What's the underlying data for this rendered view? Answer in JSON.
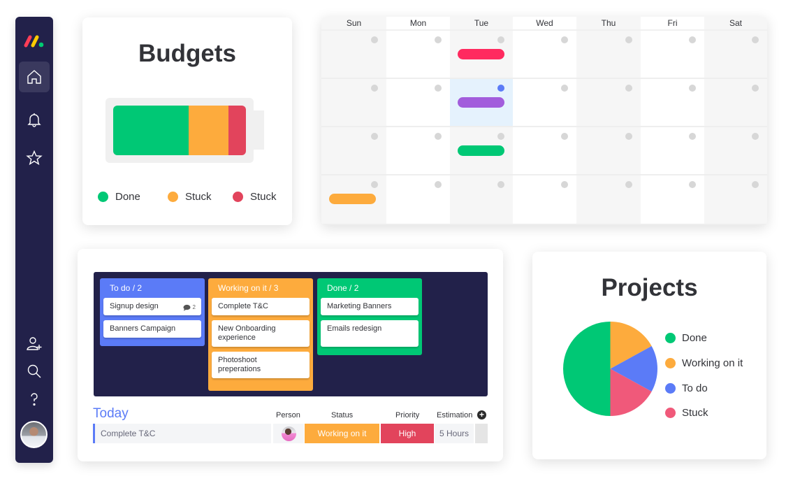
{
  "colors": {
    "navy": "#22214a",
    "green": "#00c875",
    "orange": "#fdab3d",
    "red": "#e2445c",
    "pink_red": "#ff2a5f",
    "purple": "#a25ddc",
    "blue": "#5b7bf7",
    "stuck_pink": "#f0597a"
  },
  "sidebar": {
    "items": [
      {
        "name": "home",
        "label": "Home",
        "active": true
      },
      {
        "name": "notifications",
        "label": "Notifications"
      },
      {
        "name": "favorites",
        "label": "Favorites"
      },
      {
        "name": "invite",
        "label": "Invite members"
      },
      {
        "name": "search",
        "label": "Search"
      },
      {
        "name": "help",
        "label": "Help"
      }
    ]
  },
  "budgets": {
    "title": "Budgets",
    "segments": [
      {
        "label": "Done",
        "fraction": 0.57,
        "color": "#00c875"
      },
      {
        "label": "Stuck",
        "fraction": 0.3,
        "color": "#fdab3d"
      },
      {
        "label": "Stuck",
        "fraction": 0.13,
        "color": "#e2445c"
      }
    ],
    "legend": [
      "Done",
      "Stuck",
      "Stuck"
    ]
  },
  "calendar": {
    "days": [
      "Sun",
      "Mon",
      "Tue",
      "Wed",
      "Thu",
      "Fri",
      "Sat"
    ],
    "weeks": 4,
    "events": [
      {
        "week": 0,
        "day": 2,
        "color": "#ff2a5f"
      },
      {
        "week": 1,
        "day": 2,
        "color": "#a25ddc"
      },
      {
        "week": 2,
        "day": 2,
        "color": "#00c875"
      },
      {
        "week": 3,
        "day": 0,
        "color": "#fdab3d"
      }
    ],
    "highlight": {
      "week": 1,
      "day": 2
    }
  },
  "kanban": {
    "columns": [
      {
        "title": "To do / 2",
        "color": "#5b7bf7",
        "items": [
          {
            "text": "Signup design",
            "comments": "2"
          },
          {
            "text": "Banners Campaign"
          }
        ]
      },
      {
        "title": "Working on it / 3",
        "color": "#fdab3d",
        "items": [
          {
            "text": "Complete T&C"
          },
          {
            "text": "New Onboarding experience"
          },
          {
            "text": "Photoshoot preperations"
          }
        ]
      },
      {
        "title": "Done / 2",
        "color": "#00c875",
        "items": [
          {
            "text": "Marketing Banners"
          },
          {
            "text": "Emails redesign"
          }
        ]
      }
    ]
  },
  "today": {
    "title": "Today",
    "headers": {
      "person": "Person",
      "status": "Status",
      "priority": "Priority",
      "estimation": "Estimation",
      "add": "+"
    },
    "row": {
      "name": "Complete T&C",
      "status": "Working on it",
      "priority": "High",
      "estimation": "5 Hours"
    }
  },
  "projects": {
    "title": "Projects",
    "legend": [
      "Done",
      "Working on it",
      "To do",
      "Stuck"
    ]
  },
  "chart_data": {
    "type": "pie",
    "title": "Projects",
    "categories": [
      "Done",
      "Working on it",
      "To do",
      "Stuck"
    ],
    "values": [
      50,
      17,
      16,
      17
    ],
    "colors": [
      "#00c875",
      "#fdab3d",
      "#5b7bf7",
      "#f0597a"
    ],
    "legend_position": "right"
  }
}
